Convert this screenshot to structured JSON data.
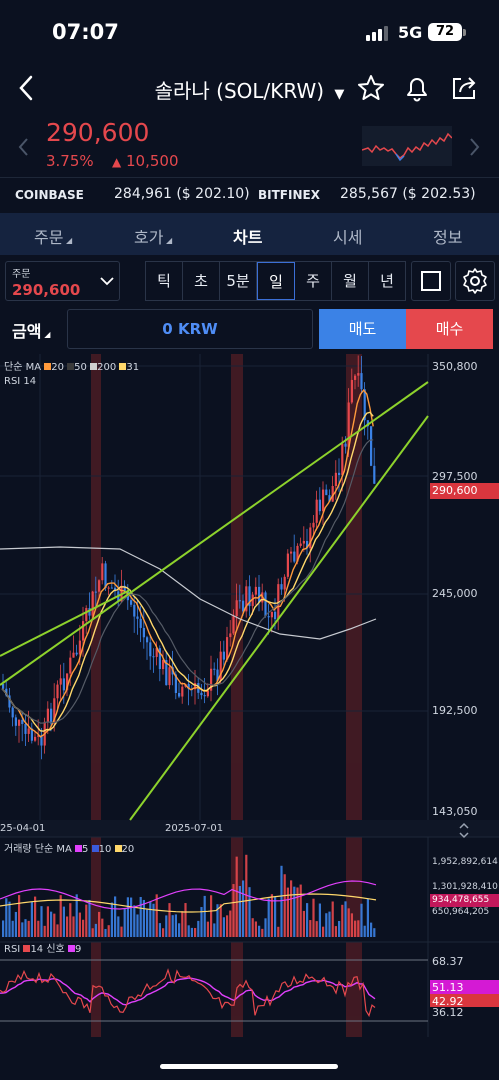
{
  "status": {
    "time": "07:07",
    "network": "5G",
    "battery": "72"
  },
  "header": {
    "title": "솔라나 (SOL/KRW)"
  },
  "ticker": {
    "price": "290,600",
    "change_pct": "3.75%",
    "change_amount": "10,500",
    "up_arrow": "▲"
  },
  "exchanges": [
    {
      "name": "COINBASE",
      "value": "284,961 ($ 202.10)"
    },
    {
      "name": "BITFINEX",
      "value": "285,567 ($ 202.53)"
    }
  ],
  "tabs": [
    "주문",
    "호가",
    "차트",
    "시세",
    "정보"
  ],
  "active_tab": "차트",
  "order": {
    "label": "주문",
    "value": "290,600"
  },
  "timeframes": [
    "틱",
    "초",
    "5분",
    "일",
    "주",
    "월",
    "년"
  ],
  "active_timeframe": "일",
  "trade": {
    "amount_label": "금액",
    "amount_value": "0 KRW",
    "sell_label": "매도",
    "buy_label": "매수"
  },
  "chart": {
    "ma_legend": {
      "prefix": "단순 MA",
      "p1": "20",
      "p2": "50",
      "p3": "200",
      "p4": "31"
    },
    "rsi_label": "RSI 14",
    "price_ticks": [
      "350,800",
      "297,500",
      "245,000",
      "192,500",
      "143,050"
    ],
    "current_price_tag": "290,600",
    "date_labels": [
      "25-04-01",
      "2025-07-01"
    ],
    "volume_legend": {
      "prefix": "거래량 단순 MA",
      "p1": "5",
      "p2": "10",
      "p3": "20"
    },
    "volume_ticks": [
      "1,952,892,614",
      "1,301,928,410",
      "650,964,205"
    ],
    "volume_tag": "934,478,655",
    "rsi_legend": {
      "prefix": "RSI",
      "p1": "14",
      "mid": "신호",
      "p2": "9"
    },
    "rsi_ticks": [
      "68.37",
      "36.12"
    ],
    "rsi_tags": [
      "51.13",
      "42.92"
    ]
  },
  "colors": {
    "up": "#e5484d",
    "down": "#3b82e6",
    "trend": "#8dd22c",
    "ma20": "#ff9a3c",
    "ma31": "#ffd86b"
  }
}
